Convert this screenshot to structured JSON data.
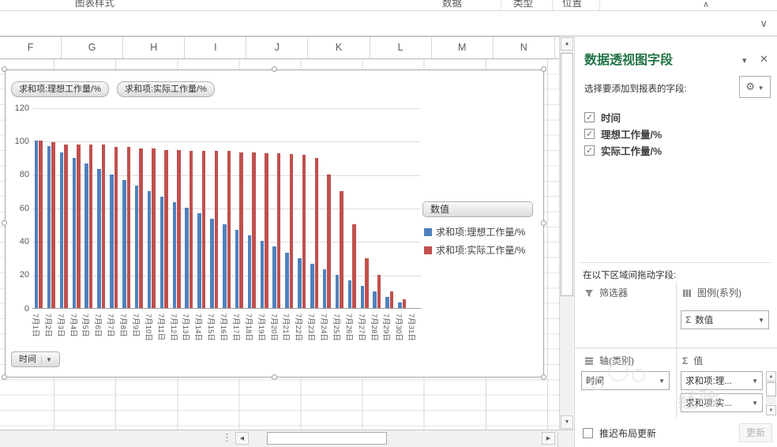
{
  "ribbon": {
    "left_group_label": "图表样式",
    "group_labels": [
      "数据",
      "类型",
      "位置"
    ],
    "collapse_icon": "∧"
  },
  "formula_bar": {
    "expand_icon": "∨"
  },
  "sheet": {
    "columns": [
      "F",
      "G",
      "H",
      "I",
      "J",
      "K",
      "L",
      "M",
      "N"
    ]
  },
  "chart": {
    "value_field_buttons": [
      "求和项:理想工作量/%",
      "求和项:实际工作量/%"
    ],
    "axis_field_button": "时间",
    "legend_field_button": "数值",
    "legend": [
      {
        "label": "求和项:理想工作量/%",
        "color": "#4F81BD"
      },
      {
        "label": "求和项:实际工作量/%",
        "color": "#C0504D"
      }
    ]
  },
  "chart_data": {
    "type": "bar",
    "title": "",
    "xlabel": "",
    "ylabel": "",
    "ylim": [
      0,
      120
    ],
    "yticks": [
      0,
      20,
      40,
      60,
      80,
      100,
      120
    ],
    "grid": true,
    "legend_position": "right",
    "categories": [
      "7月1日",
      "7月2日",
      "7月3日",
      "7月4日",
      "7月5日",
      "7月6日",
      "7月7日",
      "7月8日",
      "7月9日",
      "7月10日",
      "7月11日",
      "7月12日",
      "7月13日",
      "7月14日",
      "7月15日",
      "7月16日",
      "7月17日",
      "7月18日",
      "7月19日",
      "7月20日",
      "7月21日",
      "7月22日",
      "7月23日",
      "7月24日",
      "7月25日",
      "7月26日",
      "7月27日",
      "7月28日",
      "7月29日",
      "7月30日",
      "7月31日"
    ],
    "series": [
      {
        "name": "求和项:理想工作量/%",
        "color": "#4F81BD",
        "values": [
          100,
          96.7,
          93.3,
          90,
          86.7,
          83.3,
          80,
          76.7,
          73.3,
          70,
          66.7,
          63.3,
          60,
          56.7,
          53.3,
          50,
          46.7,
          43.3,
          40,
          36.7,
          33.3,
          30,
          26.7,
          23.3,
          20,
          16.7,
          13.3,
          10,
          6.7,
          3.3,
          0
        ]
      },
      {
        "name": "求和项:实际工作量/%",
        "color": "#C0504D",
        "values": [
          100,
          99,
          98,
          98,
          98,
          98,
          96.5,
          96.5,
          95.5,
          95.5,
          94.7,
          94.7,
          94,
          94,
          93.8,
          93.8,
          93,
          93,
          92.6,
          92.6,
          92.2,
          91.8,
          90,
          80,
          70,
          50,
          30,
          20,
          10,
          5,
          0
        ]
      }
    ]
  },
  "panel": {
    "title": "数据透视图字段",
    "collapse_icon": "▾",
    "close_icon": "✕",
    "subtitle": "选择要添加到报表的字段:",
    "gear_icon": "⚙",
    "fields": [
      {
        "label": "时间",
        "checked": true
      },
      {
        "label": "理想工作量/%",
        "checked": true
      },
      {
        "label": "实际工作量/%",
        "checked": true
      }
    ],
    "drag_hint": "在以下区域间拖动字段:",
    "zones": {
      "filters": {
        "label": "筛选器",
        "items": []
      },
      "legend": {
        "label": "图例(系列)",
        "items": [
          {
            "label": "数值",
            "sigma": true
          }
        ]
      },
      "axis": {
        "label": "轴(类别)",
        "items": [
          {
            "label": "时间",
            "sigma": false
          }
        ]
      },
      "values": {
        "label": "值",
        "items": [
          {
            "label": "求和项:理...",
            "sigma": false
          },
          {
            "label": "求和项:实...",
            "sigma": false
          }
        ]
      }
    },
    "defer_label": "推迟布局更新",
    "update_button": "更新"
  },
  "watermark": {
    "text": "经验"
  }
}
